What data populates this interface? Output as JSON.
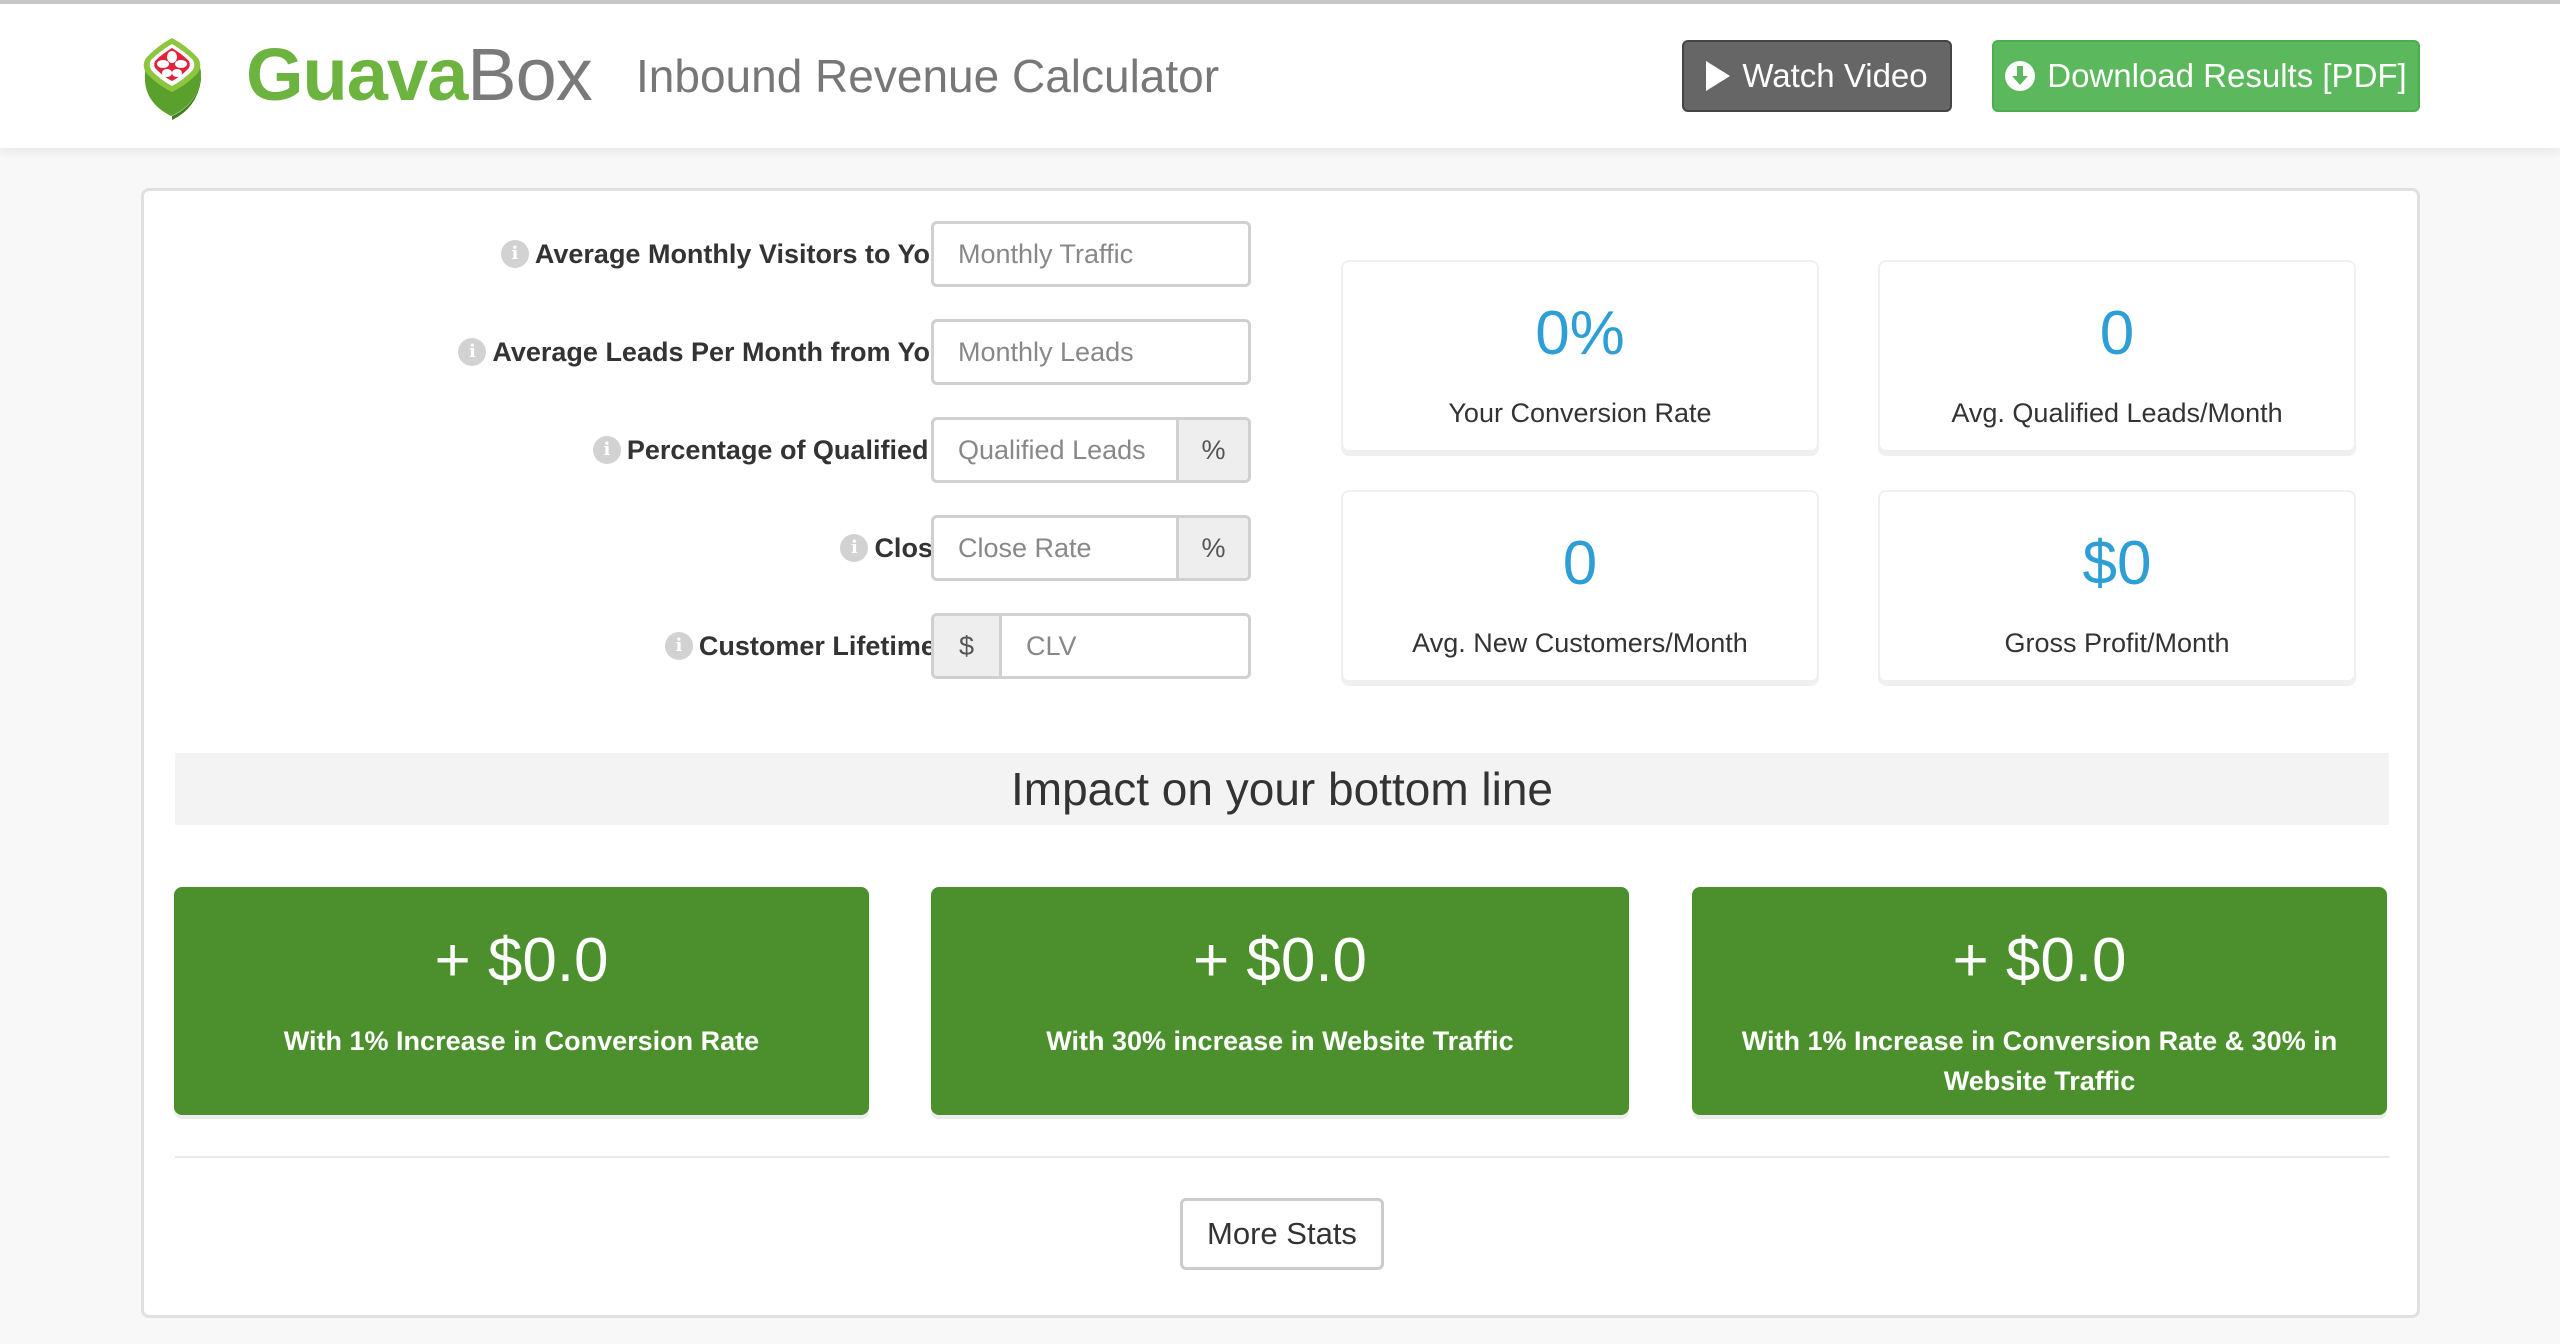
{
  "header": {
    "logo": {
      "brand_primary": "Guava",
      "brand_secondary": "Box",
      "icon": "guava-fruit-icon"
    },
    "title": "Inbound Revenue Calculator",
    "watch_video": {
      "label": "Watch Video",
      "icon": "play-icon"
    },
    "download": {
      "label": "Download Results [PDF]",
      "icon": "download-circle-icon"
    }
  },
  "form": {
    "fields": [
      {
        "label": "Average Monthly Visitors to Your Site",
        "placeholder": "Monthly Traffic",
        "value": "",
        "addon": null
      },
      {
        "label": "Average Leads Per Month from Your Site",
        "placeholder": "Monthly Leads",
        "value": "",
        "addon": null
      },
      {
        "label": "Percentage of Qualified Leads",
        "placeholder": "Qualified Leads",
        "value": "",
        "addon": "%"
      },
      {
        "label": "Close Rate",
        "placeholder": "Close Rate",
        "value": "",
        "addon": "%"
      },
      {
        "label": "Customer Lifetime Value",
        "placeholder": "CLV",
        "value": "",
        "addon": "$"
      }
    ],
    "info_icon": "i"
  },
  "stats": [
    {
      "value": "0%",
      "label": "Your Conversion Rate"
    },
    {
      "value": "0",
      "label": "Avg. Qualified Leads/Month"
    },
    {
      "value": "0",
      "label": "Avg. New Customers/Month"
    },
    {
      "value": "$0",
      "label": "Gross Profit/Month"
    }
  ],
  "impact": {
    "title": "Impact on your bottom line",
    "tiles": [
      {
        "value": "+ $0.0",
        "label": "With 1% Increase in Conversion Rate"
      },
      {
        "value": "+ $0.0",
        "label": "With 30% increase in Website Traffic"
      },
      {
        "value": "+ $0.0",
        "label": "With 1% Increase in Conversion Rate & 30% in Website Traffic"
      }
    ]
  },
  "more_stats_label": "More Stats",
  "colors": {
    "brand_green": "#6cb33f",
    "stat_blue": "#2e9fd6",
    "tile_green": "#4b902c",
    "download_green": "#5cb85c",
    "video_grey": "#666666"
  }
}
